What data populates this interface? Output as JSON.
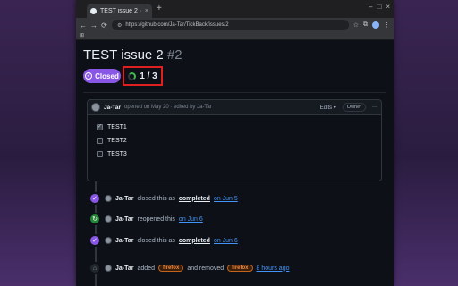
{
  "browser": {
    "tab_title": "TEST issue 2 · Issue #2",
    "tab_close": "×",
    "new_tab": "+",
    "window_controls": [
      "–",
      "□",
      "×"
    ],
    "url": "https://github.com/Ja-Tar/TickBack/issues/2",
    "nav": {
      "back": "←",
      "forward": "→",
      "reload": "⟳"
    },
    "bookmarks_icon": "⊞"
  },
  "issue": {
    "title": "TEST issue 2",
    "number": "#2",
    "state_label": "Closed",
    "progress_text": "1 / 3",
    "progress_completed": 1,
    "progress_total": 3
  },
  "comment": {
    "author": "Ja-Tar",
    "meta": "opened on May 20 · edited by Ja-Tar",
    "edits_label": "Edits ▾",
    "owner_label": "Owner",
    "more_label": "···",
    "tasks": [
      {
        "label": "TEST1",
        "checked": true
      },
      {
        "label": "TEST2",
        "checked": false
      },
      {
        "label": "TEST3",
        "checked": false
      }
    ]
  },
  "timeline": [
    {
      "who": "Ja-Tar",
      "pre": "closed this as",
      "strong": "completed",
      "date": "on Jun 5",
      "color": "#8957e5"
    },
    {
      "who": "Ja-Tar",
      "pre": "reopened this",
      "date": "on Jun 6",
      "color": "#238636"
    },
    {
      "who": "Ja-Tar",
      "pre": "closed this as",
      "strong": "completed",
      "date": "on Jun 6",
      "color": "#8957e5"
    },
    {
      "who": "Ja-Tar",
      "pre": "added",
      "label1": "firefox",
      "mid": "and removed",
      "label2": "firefox",
      "date": "8 hours ago"
    }
  ]
}
